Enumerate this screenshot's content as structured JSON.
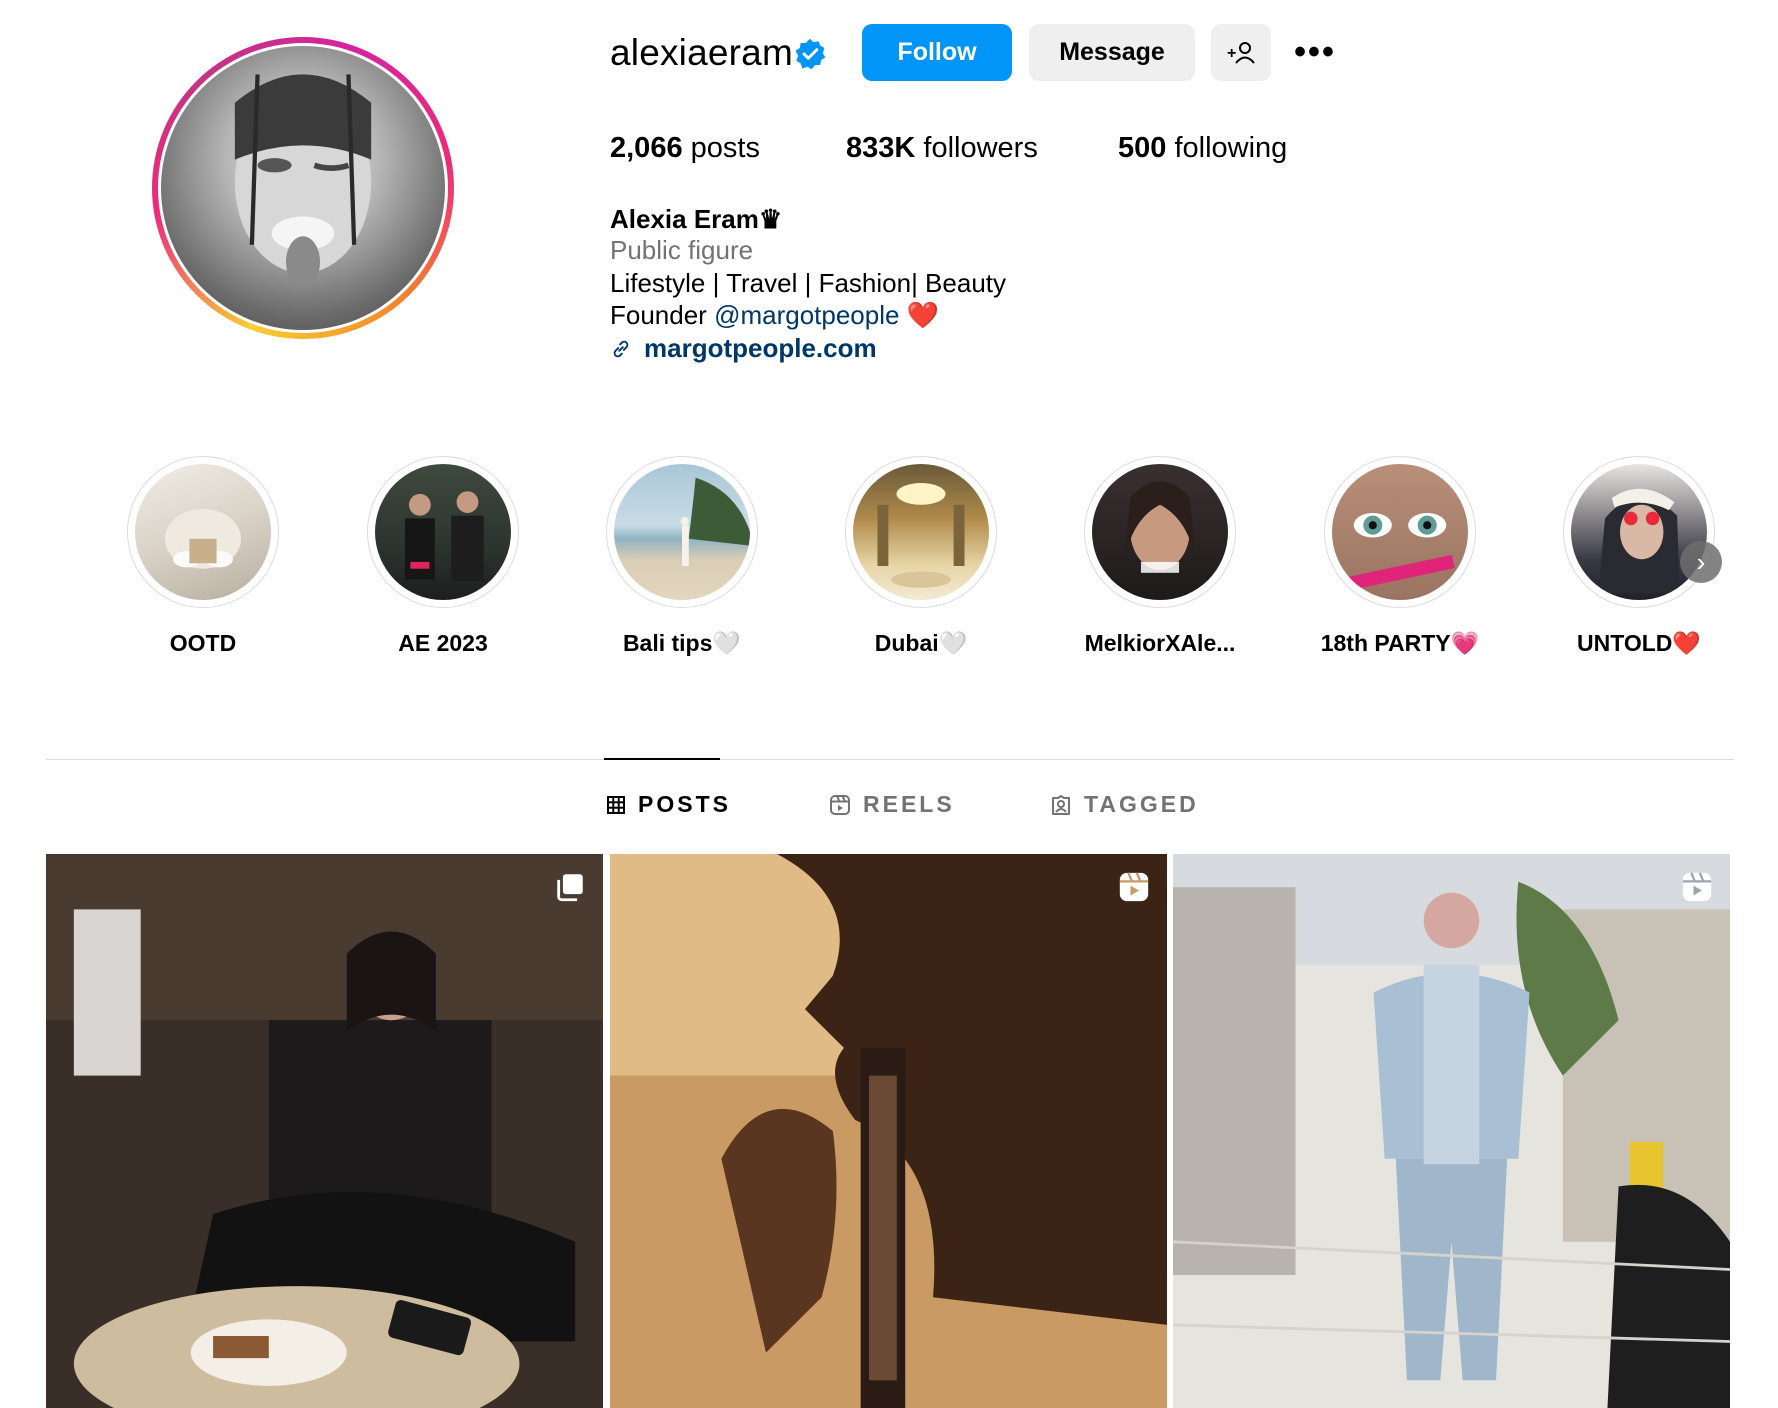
{
  "profile": {
    "username": "alexiaeram",
    "verified": true,
    "follow_label": "Follow",
    "message_label": "Message",
    "add_user_icon": "add-user-icon",
    "more_icon": "more-horizontal-icon",
    "more_label": "•••"
  },
  "stats": {
    "posts_count": "2,066",
    "posts_label": "posts",
    "followers_count": "833K",
    "followers_label": "followers",
    "following_count": "500",
    "following_label": "following"
  },
  "bio": {
    "full_name": "Alexia Eram♛",
    "category": "Public figure",
    "line1": "Lifestyle | Travel | Fashion| Beauty",
    "line2_prefix": "Founder ",
    "line2_mention": "@margotpeople",
    "line2_suffix": " ❤️",
    "link": "margotpeople.com"
  },
  "highlights": [
    {
      "label": "OOTD"
    },
    {
      "label": "AE 2023"
    },
    {
      "label": "Bali tips🤍"
    },
    {
      "label": "Dubai🤍"
    },
    {
      "label": "MelkiorXAle..."
    },
    {
      "label": "18th PARTY💗"
    },
    {
      "label": "UNTOLD❤️"
    }
  ],
  "tabs": [
    {
      "label": "POSTS",
      "icon": "grid-icon",
      "active": true
    },
    {
      "label": "REELS",
      "icon": "reels-icon",
      "active": false
    },
    {
      "label": "TAGGED",
      "icon": "tagged-icon",
      "active": false
    }
  ],
  "posts": [
    {
      "badge": "carousel-icon"
    },
    {
      "badge": "reel-icon"
    },
    {
      "badge": "reel-icon"
    }
  ],
  "colors": {
    "accent": "#0095f6",
    "link": "#00376b",
    "muted": "#737373",
    "button_gray": "#efefef"
  }
}
